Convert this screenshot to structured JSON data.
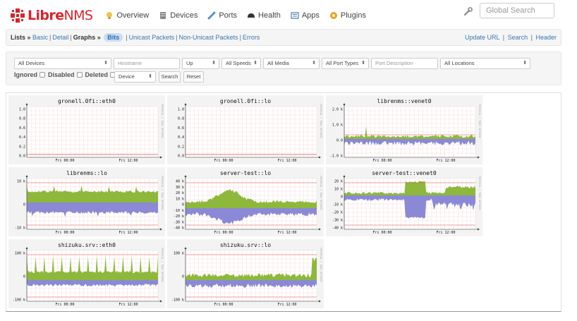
{
  "app": {
    "brand_libre": "Libre",
    "brand_nms": "NMS",
    "colors": {
      "brand_red": "#d9232e",
      "link_blue": "#3a77b3",
      "in_green": "#8db83b",
      "out_blue": "#8b89d6",
      "grid_red": "#f0c8c8",
      "threshold_red": "#e05050"
    }
  },
  "nav": {
    "items": [
      {
        "label": "Overview",
        "icon": "lightbulb-icon"
      },
      {
        "label": "Devices",
        "icon": "server-icon"
      },
      {
        "label": "Ports",
        "icon": "link-icon"
      },
      {
        "label": "Health",
        "icon": "heartbeat-icon"
      },
      {
        "label": "Apps",
        "icon": "apps-icon"
      },
      {
        "label": "Plugins",
        "icon": "plugin-icon"
      }
    ],
    "search_placeholder": "Global Search"
  },
  "crumbs": {
    "lists": "Lists »",
    "basic": "Basic",
    "detail": "Detail",
    "graphs": "Graphs »",
    "bits": "Bits",
    "unicast": "Unicast Packets",
    "nonunicast": "Non-Unicast Packets",
    "errors": "Errors",
    "update_url": "Update URL",
    "search": "Search",
    "header": "Header"
  },
  "filters": {
    "devices": "All Devices",
    "hostname_placeholder": "Hostname",
    "state": "Up",
    "speeds": "All Speeds",
    "media": "All Media",
    "port_types": "All Port Types",
    "description_placeholder": "Port Description",
    "locations": "All Locations",
    "ignored": "Ignored",
    "disabled": "Disabled",
    "deleted": "Deleted",
    "sort": "Device",
    "search_btn": "Search",
    "reset_btn": "Reset"
  },
  "graphs": [
    {
      "title": "gronell.0fi::eth0",
      "side": "PROTOCOL / TOBI OETIKER",
      "type": "empty",
      "y_ticks": [
        "1.0",
        "0.8",
        "0.6",
        "0.4",
        "0.2",
        "0.0"
      ],
      "x_ticks": [
        "Fri 00:00",
        "Fri 12:00"
      ]
    },
    {
      "title": "gronell.0fi::lo",
      "side": "PROTOCOL / TOBI OETIKER",
      "type": "empty",
      "y_ticks": [
        "1.0",
        "0.8",
        "0.6",
        "0.4",
        "0.2",
        "0.0"
      ],
      "x_ticks": [
        "Fri 00:00",
        "Fri 12:00"
      ]
    },
    {
      "title": "librenms::venet0",
      "side": "PROTOCOL / TOBI OETIKER",
      "type": "small",
      "y_ticks": [
        "2.0 k",
        "1.0 k",
        "0.0",
        "-1.0 k"
      ],
      "x_ticks": [
        "Fri 00:00",
        "Fri 12:00"
      ]
    },
    {
      "title": "librenms::lo",
      "side": "PROTOCOL / TOBI OETIKER",
      "type": "band",
      "y_ticks": [
        "10 k",
        "0",
        "-10 k"
      ],
      "x_ticks": [
        "Fri 00:00",
        "Fri 12:00"
      ]
    },
    {
      "title": "server-test::lo",
      "side": "PROTOCOL / TOBI OETIKER",
      "type": "wave",
      "y_ticks": [
        "40 k",
        "30 k",
        "20 k",
        "10 k",
        "0",
        "-10 k",
        "-20 k",
        "-30 k",
        "-40 k"
      ],
      "x_ticks": [
        "Fri 00:00",
        "Fri 12:00"
      ]
    },
    {
      "title": "server-test::venet0",
      "side": "PROTOCOL / TOBI OETIKER",
      "type": "blocks",
      "y_ticks": [
        "20 k",
        "10 k",
        "0",
        "-10 k",
        "-20 k",
        "-30 k",
        "-40 k"
      ],
      "x_ticks": [
        "Fri 00:00",
        "Fri 12:00"
      ]
    },
    {
      "title": "shizuku.srv::eth0",
      "side": "PROTOCOL / TOBI OETIKER",
      "type": "spikes",
      "y_ticks": [
        "100 k",
        "0",
        "-100 k"
      ],
      "x_ticks": [
        "Fri 00:00",
        "Fri 12:00"
      ]
    },
    {
      "title": "shizuku.srv::lo",
      "side": "PROTOCOL / TOBI OETIKER",
      "type": "noisy",
      "y_ticks": [
        "100 k",
        "0",
        "-100 k"
      ],
      "x_ticks": [
        "Fri 00:00",
        "Fri 12:00"
      ]
    }
  ]
}
